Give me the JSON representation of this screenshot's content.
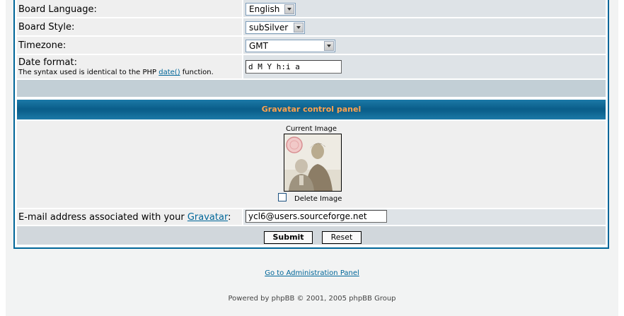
{
  "profile": {
    "board_language_label": "Board Language:",
    "board_language_value": "English",
    "board_style_label": "Board Style:",
    "board_style_value": "subSilver",
    "timezone_label": "Timezone:",
    "timezone_value": "GMT",
    "date_format_label": "Date format:",
    "date_format_help_before": "The syntax used is identical to the PHP ",
    "date_format_help_link": "date()",
    "date_format_help_after": " function.",
    "date_format_value": "d M Y h:i a"
  },
  "gravatar": {
    "panel_title": "Gravatar control panel",
    "current_image_label": "Current Image",
    "delete_image_label": "Delete Image",
    "delete_image_checked": false,
    "email_label_before": "E-mail address associated with your ",
    "email_label_link": "Gravatar",
    "email_label_after": ":",
    "email_value": "ycl6@users.sourceforge.net"
  },
  "actions": {
    "submit_label": "Submit",
    "reset_label": "Reset"
  },
  "footer": {
    "admin_link": "Go to Administration Panel",
    "powered_by": "Powered by phpBB © 2001, 2005 phpBB Group"
  },
  "colors": {
    "accent": "#006699",
    "catbar_text": "#ffa34f",
    "row_light": "#efefef",
    "row_field": "#dee3e7"
  }
}
